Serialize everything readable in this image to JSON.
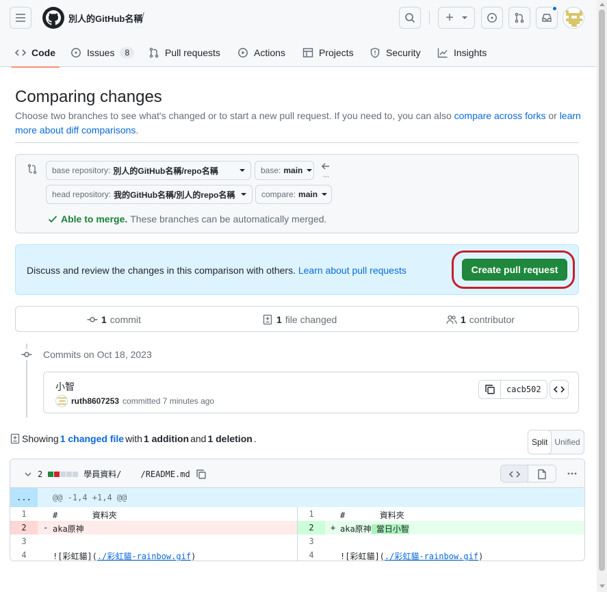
{
  "header": {
    "owner": "別人的GitHub名稱",
    "separator": "/",
    "plus_label": "+"
  },
  "tabs": [
    {
      "label": "Code",
      "icon": "code-icon"
    },
    {
      "label": "Issues",
      "count": "8",
      "icon": "issue-icon"
    },
    {
      "label": "Pull requests",
      "icon": "pull-request-icon"
    },
    {
      "label": "Actions",
      "icon": "play-icon"
    },
    {
      "label": "Projects",
      "icon": "table-icon"
    },
    {
      "label": "Security",
      "icon": "shield-icon"
    },
    {
      "label": "Insights",
      "icon": "graph-icon"
    }
  ],
  "compare": {
    "title": "Comparing changes",
    "desc_pre": "Choose two branches to see what's changed or to start a new pull request. If you need to, you can also ",
    "link1": "compare across forks",
    "desc_mid": " or ",
    "link2": "learn more about diff comparisons",
    "desc_post": ".",
    "base_repo_label": "base repository:",
    "base_repo_value": "別人的GitHub名稱/repo名稱",
    "base_label": "base:",
    "base_value": "main",
    "head_repo_label": "head repository:",
    "head_repo_value": "我的GitHub名稱/別人的repo名稱",
    "compare_label": "compare:",
    "compare_value": "main",
    "merge_status": "Able to merge.",
    "merge_desc": "These branches can be automatically merged."
  },
  "flash": {
    "text": "Discuss and review the changes in this comparison with others.",
    "link": "Learn about pull requests",
    "button": "Create pull request"
  },
  "stats": {
    "commits_n": "1",
    "commits_label": "commit",
    "files_n": "1",
    "files_label": "file changed",
    "contrib_n": "1",
    "contrib_label": "contributor"
  },
  "commits": {
    "date_label": "Commits on Oct 18, 2023",
    "title": "小智",
    "author": "ruth8607253",
    "meta": "committed 7 minutes ago",
    "sha": "cacb502"
  },
  "summary": {
    "pre": "Showing ",
    "link": "1 changed file",
    "mid": " with ",
    "additions": "1 addition",
    "and": " and ",
    "deletions": "1 deletion",
    "end": "."
  },
  "view": {
    "split": "Split",
    "unified": "Unified"
  },
  "file": {
    "changes": "2",
    "path_dir": "學員資料/",
    "path_file": "/README.md",
    "hunk_expand": "...",
    "hunk_header": "@@ -1,4 +1,4 @@"
  },
  "diff": {
    "left": [
      {
        "ln": "1",
        "sign": "",
        "code": "#       資料夾"
      },
      {
        "ln": "2",
        "sign": "-",
        "code": "aka原神"
      },
      {
        "ln": "3",
        "sign": "",
        "code": ""
      },
      {
        "ln": "4",
        "sign": "",
        "code_pre": "![彩虹貓](",
        "code_link": "./彩虹貓-rainbow.gif",
        "code_post": ")"
      }
    ],
    "right": [
      {
        "ln": "1",
        "sign": "",
        "code": "#       資料夾"
      },
      {
        "ln": "2",
        "sign": "+",
        "code": "aka原神",
        "code_added": " 當日小智"
      },
      {
        "ln": "3",
        "sign": "",
        "code": ""
      },
      {
        "ln": "4",
        "sign": "",
        "code_pre": "![彩虹貓](",
        "code_link": "./彩虹貓-rainbow.gif",
        "code_post": ")"
      }
    ]
  },
  "colors": {
    "accent": "#0969da",
    "create_button": "#1f883d",
    "highlight_ring": "#c41f2d",
    "merge_ok": "#1a7f37"
  }
}
